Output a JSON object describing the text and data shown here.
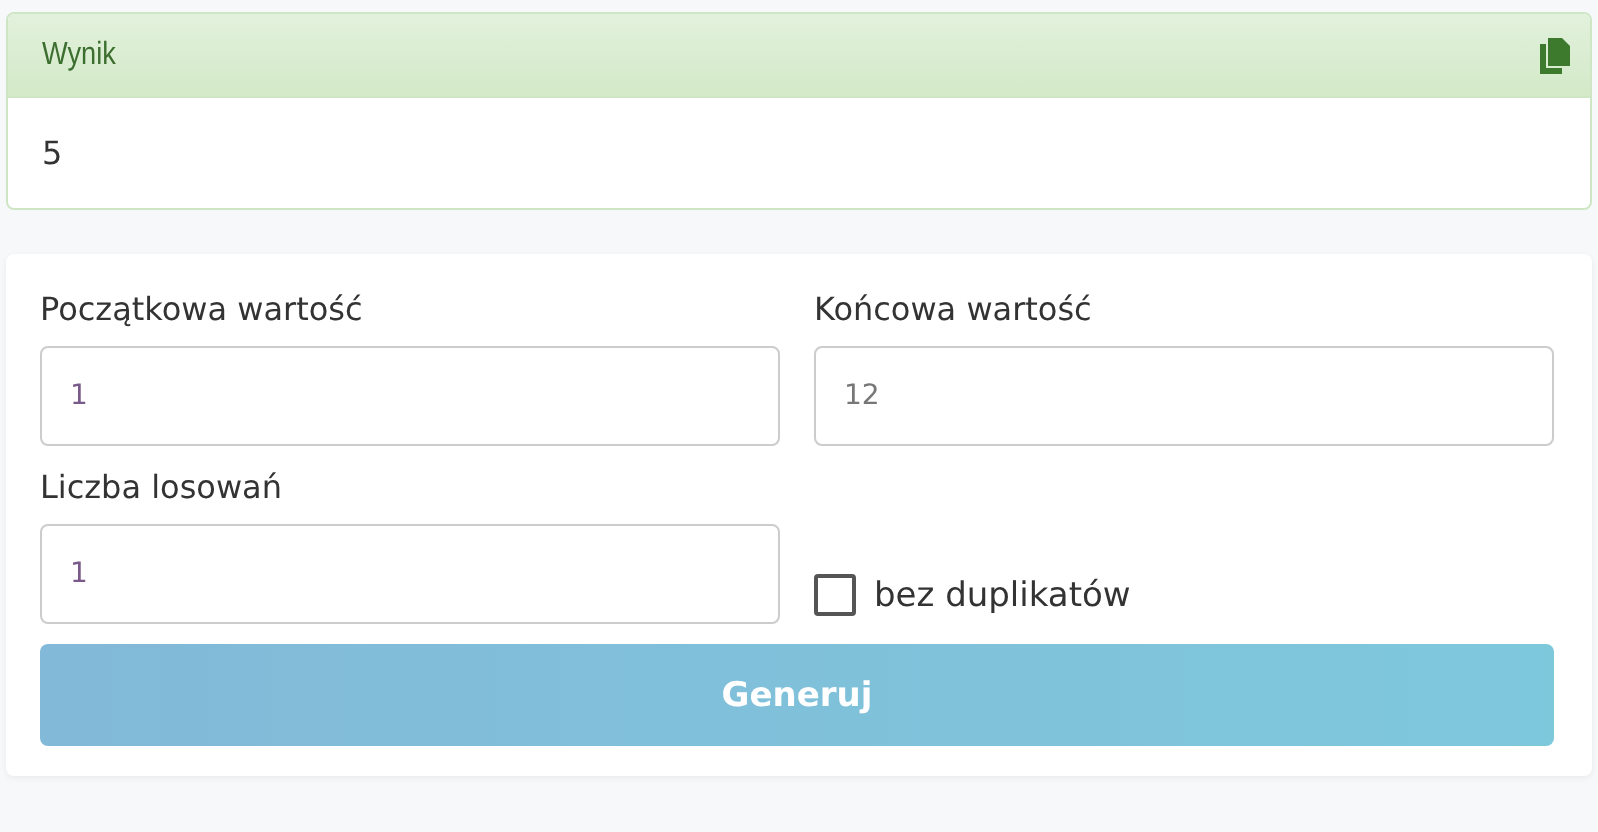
{
  "result": {
    "title": "Wynik",
    "value": "5"
  },
  "form": {
    "fields": [
      {
        "label": "Początkowa wartość",
        "value": "1"
      },
      {
        "label": "Końcowa wartość",
        "placeholder": "12"
      },
      {
        "label": "Liczba losowań",
        "value": "1"
      }
    ],
    "no_duplicates": {
      "label": "bez duplikatów",
      "checked": false
    },
    "button": "Generuj"
  }
}
